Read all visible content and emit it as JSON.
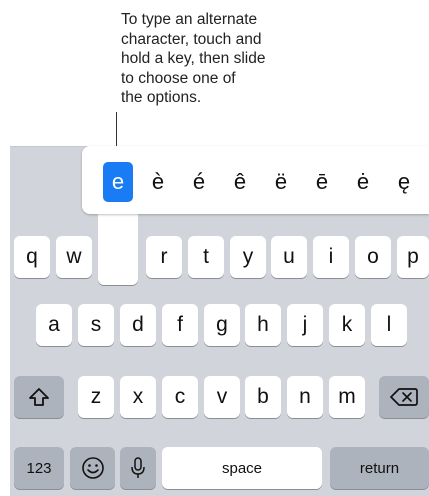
{
  "callout": {
    "lines": [
      "To type an alternate",
      "character, touch and",
      "hold a key, then slide",
      "to choose one of",
      "the options."
    ]
  },
  "popup": {
    "options": [
      "e",
      "è",
      "é",
      "ê",
      "ë",
      "ē",
      "ė",
      "ę"
    ],
    "selected_index": 0
  },
  "keyboard": {
    "row1": [
      "q",
      "w",
      "r",
      "t",
      "y",
      "u",
      "i",
      "o",
      "p"
    ],
    "row2": [
      "a",
      "s",
      "d",
      "f",
      "g",
      "h",
      "j",
      "k",
      "l"
    ],
    "row3": [
      "z",
      "x",
      "c",
      "v",
      "b",
      "n",
      "m"
    ],
    "numbers_label": "123",
    "space_label": "space",
    "return_label": "return",
    "icons": {
      "shift": "shift-icon",
      "delete": "delete-icon",
      "emoji": "emoji-icon",
      "mic": "microphone-icon"
    },
    "colors": {
      "background": "#d1d5db",
      "key": "#ffffff",
      "dark_key": "#adb3bc",
      "selected": "#1a7cf5"
    }
  }
}
